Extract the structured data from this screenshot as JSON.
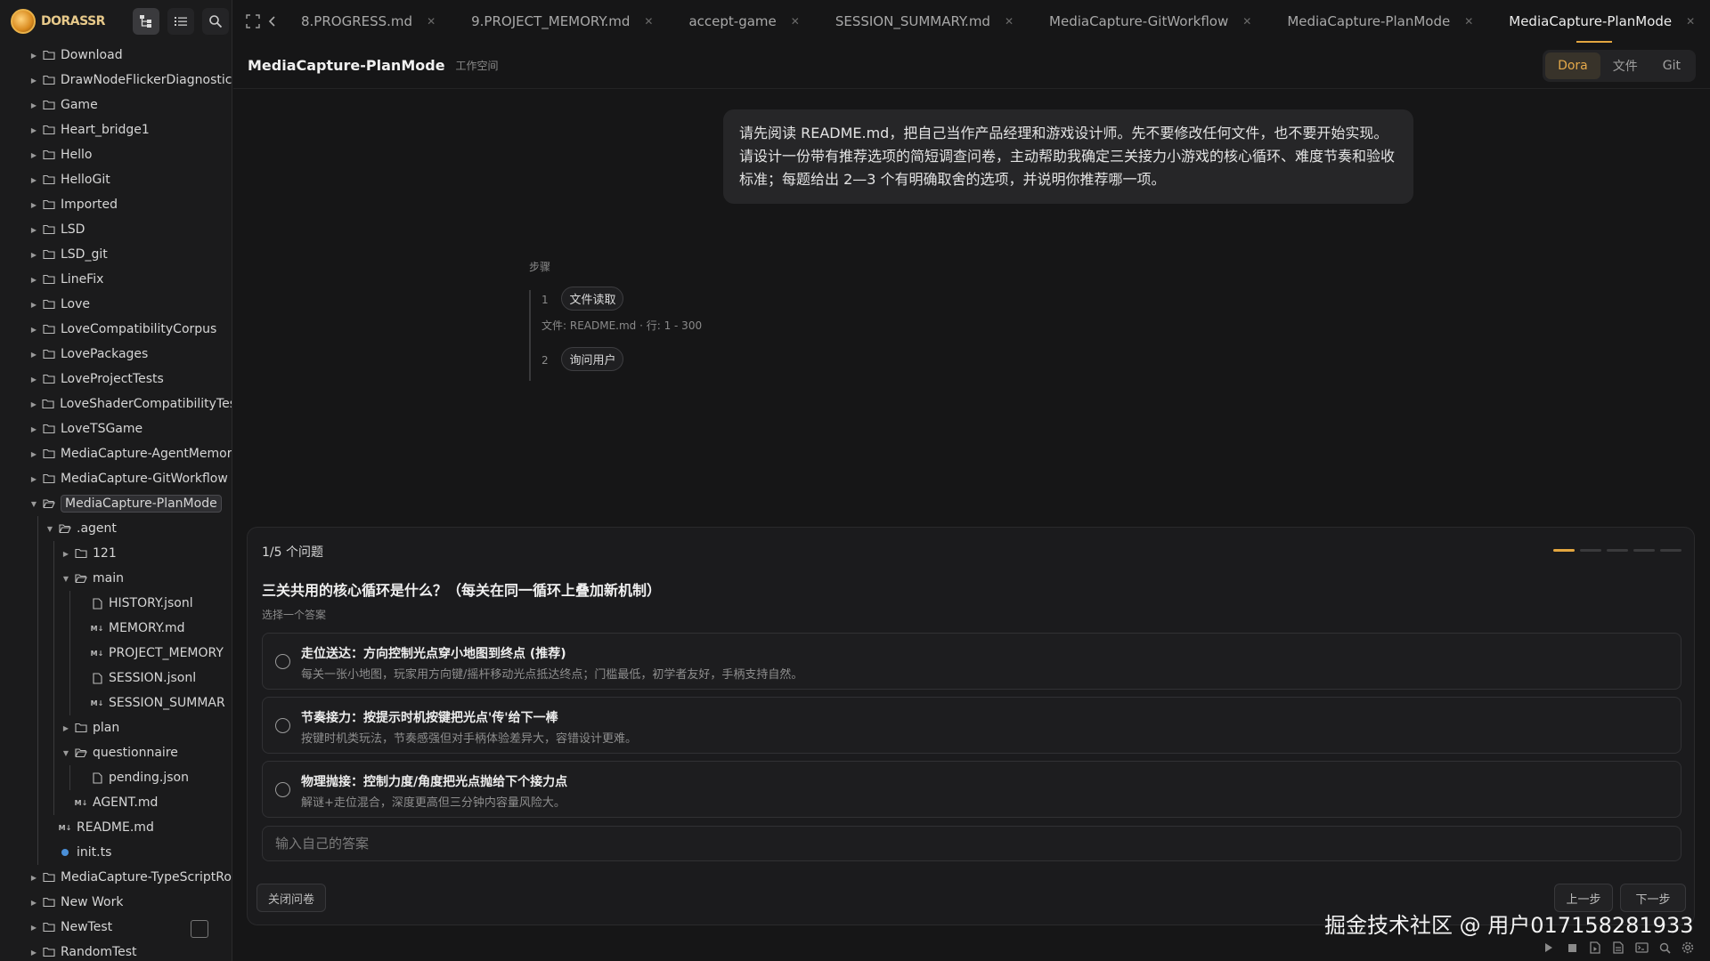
{
  "app": {
    "logo_text": "DORASSR"
  },
  "sidebar": {
    "tree": [
      {
        "label": "Download",
        "type": "folder",
        "depth": 0,
        "expanded": false
      },
      {
        "label": "DrawNodeFlickerDiagnostic",
        "type": "folder",
        "depth": 0,
        "expanded": false
      },
      {
        "label": "Game",
        "type": "folder",
        "depth": 0,
        "expanded": false
      },
      {
        "label": "Heart_bridge1",
        "type": "folder",
        "depth": 0,
        "expanded": false
      },
      {
        "label": "Hello",
        "type": "folder",
        "depth": 0,
        "expanded": false
      },
      {
        "label": "HelloGit",
        "type": "folder",
        "depth": 0,
        "expanded": false
      },
      {
        "label": "Imported",
        "type": "folder",
        "depth": 0,
        "expanded": false
      },
      {
        "label": "LSD",
        "type": "folder",
        "depth": 0,
        "expanded": false
      },
      {
        "label": "LSD_git",
        "type": "folder",
        "depth": 0,
        "expanded": false
      },
      {
        "label": "LineFix",
        "type": "folder",
        "depth": 0,
        "expanded": false
      },
      {
        "label": "Love",
        "type": "folder",
        "depth": 0,
        "expanded": false
      },
      {
        "label": "LoveCompatibilityCorpus",
        "type": "folder",
        "depth": 0,
        "expanded": false
      },
      {
        "label": "LovePackages",
        "type": "folder",
        "depth": 0,
        "expanded": false
      },
      {
        "label": "LoveProjectTests",
        "type": "folder",
        "depth": 0,
        "expanded": false
      },
      {
        "label": "LoveShaderCompatibilityTes",
        "type": "folder",
        "depth": 0,
        "expanded": false
      },
      {
        "label": "LoveTSGame",
        "type": "folder",
        "depth": 0,
        "expanded": false
      },
      {
        "label": "MediaCapture-AgentMemor",
        "type": "folder",
        "depth": 0,
        "expanded": false
      },
      {
        "label": "MediaCapture-GitWorkflow",
        "type": "folder",
        "depth": 0,
        "expanded": false
      },
      {
        "label": "MediaCapture-PlanMode",
        "type": "folder",
        "depth": 0,
        "expanded": true,
        "selected": true
      },
      {
        "label": ".agent",
        "type": "folder",
        "depth": 1,
        "expanded": true
      },
      {
        "label": "121",
        "type": "folder",
        "depth": 2,
        "expanded": false
      },
      {
        "label": "main",
        "type": "folder",
        "depth": 2,
        "expanded": true
      },
      {
        "label": "HISTORY.jsonl",
        "type": "file",
        "depth": 3
      },
      {
        "label": "MEMORY.md",
        "type": "md",
        "depth": 3
      },
      {
        "label": "PROJECT_MEMORY",
        "type": "md",
        "depth": 3
      },
      {
        "label": "SESSION.jsonl",
        "type": "file",
        "depth": 3
      },
      {
        "label": "SESSION_SUMMAR",
        "type": "md",
        "depth": 3
      },
      {
        "label": "plan",
        "type": "folder",
        "depth": 2,
        "expanded": false
      },
      {
        "label": "questionnaire",
        "type": "folder",
        "depth": 2,
        "expanded": true
      },
      {
        "label": "pending.json",
        "type": "file",
        "depth": 3
      },
      {
        "label": "AGENT.md",
        "type": "md",
        "depth": 2
      },
      {
        "label": "README.md",
        "type": "md",
        "depth": 1
      },
      {
        "label": "init.ts",
        "type": "ts",
        "depth": 1
      },
      {
        "label": "MediaCapture-TypeScriptRo",
        "type": "folder",
        "depth": 0,
        "expanded": false
      },
      {
        "label": "New Work",
        "type": "folder",
        "depth": 0,
        "expanded": false
      },
      {
        "label": "NewTest",
        "type": "folder",
        "depth": 0,
        "expanded": false
      },
      {
        "label": "RandomTest",
        "type": "folder",
        "depth": 0,
        "expanded": false
      }
    ]
  },
  "tabs": [
    {
      "label": "8.PROGRESS.md",
      "active": false
    },
    {
      "label": "9.PROJECT_MEMORY.md",
      "active": false
    },
    {
      "label": "accept-game",
      "active": false
    },
    {
      "label": "SESSION_SUMMARY.md",
      "active": false
    },
    {
      "label": "MediaCapture-GitWorkflow",
      "active": false
    },
    {
      "label": "MediaCapture-PlanMode",
      "active": false
    },
    {
      "label": "MediaCapture-PlanMode",
      "active": true
    }
  ],
  "workspace": {
    "title": "MediaCapture-PlanMode",
    "subtitle": "工作空间",
    "modes": [
      "Dora",
      "文件",
      "Git"
    ],
    "active_mode": "Dora"
  },
  "chat": {
    "user_message": "请先阅读 README.md，把自己当作产品经理和游戏设计师。先不要修改任何文件，也不要开始实现。请设计一份带有推荐选项的简短调查问卷，主动帮助我确定三关接力小游戏的核心循环、难度节奏和验收标准；每题给出 2—3 个有明确取舍的选项，并说明你推荐哪一项。",
    "steps_label": "步骤",
    "steps": [
      {
        "num": "1",
        "name": "文件读取",
        "meta": "文件: README.md · 行: 1 - 300"
      },
      {
        "num": "2",
        "name": "询问用户",
        "meta": ""
      }
    ]
  },
  "questionnaire": {
    "count_text": "1/5 个问题",
    "progress": {
      "current": 1,
      "total": 5
    },
    "question": "三关共用的核心循环是什么？（每关在同一循环上叠加新机制）",
    "hint": "选择一个答案",
    "options": [
      {
        "title": "走位送达：方向控制光点穿小地图到终点 (推荐)",
        "desc": "每关一张小地图，玩家用方向键/摇杆移动光点抵达终点；门槛最低，初学者友好，手柄支持自然。"
      },
      {
        "title": "节奏接力：按提示时机按键把光点'传'给下一棒",
        "desc": "按键时机类玩法，节奏感强但对手柄体验差异大，容错设计更难。"
      },
      {
        "title": "物理抛接：控制力度/角度把光点抛给下个接力点",
        "desc": "解谜+走位混合，深度更高但三分钟内容量风险大。"
      }
    ],
    "custom_placeholder": "输入自己的答案",
    "close_label": "关闭问卷",
    "prev_label": "上一步",
    "next_label": "下一步"
  },
  "watermark": "掘金技术社区 @ 用户017158281933",
  "colors": {
    "accent": "#e3a640",
    "background": "#161617",
    "panel": "#1b1b1d"
  }
}
